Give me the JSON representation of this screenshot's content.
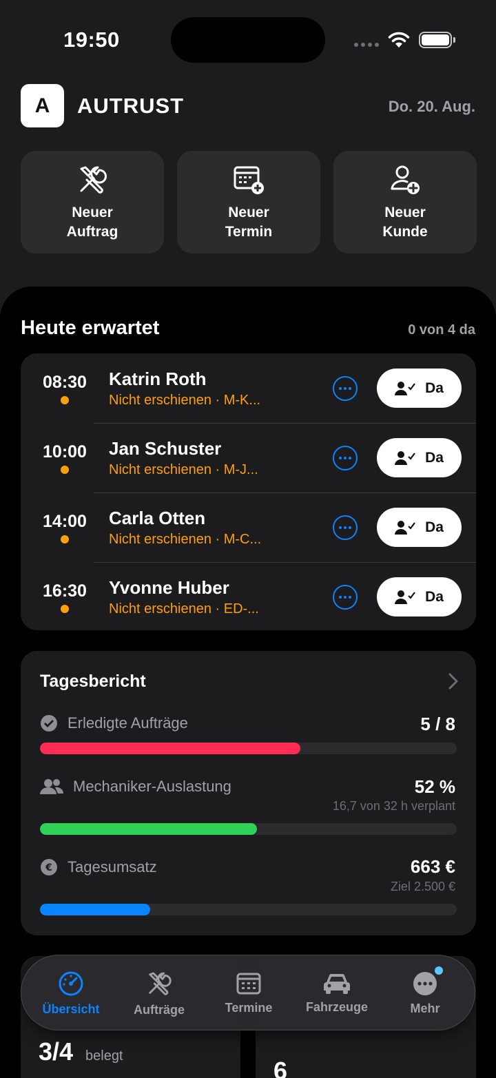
{
  "status": {
    "time": "19:50"
  },
  "header": {
    "logo_letter": "A",
    "brand": "AUTRUST",
    "date": "Do. 20. Aug."
  },
  "quick_actions": [
    {
      "label": "Neuer\nAuftrag",
      "icon": "tools-icon"
    },
    {
      "label": "Neuer\nTermin",
      "icon": "calendar-plus-icon"
    },
    {
      "label": "Neuer\nKunde",
      "icon": "person-plus-icon"
    }
  ],
  "today": {
    "title": "Heute erwartet",
    "count": "0 von 4 da",
    "appointments": [
      {
        "time": "08:30",
        "name": "Katrin Roth",
        "sub": "Nicht erschienen · M-K...",
        "button": "Da"
      },
      {
        "time": "10:00",
        "name": "Jan Schuster",
        "sub": "Nicht erschienen · M-J...",
        "button": "Da"
      },
      {
        "time": "14:00",
        "name": "Carla Otten",
        "sub": "Nicht erschienen · M-C...",
        "button": "Da"
      },
      {
        "time": "16:30",
        "name": "Yvonne Huber",
        "sub": "Nicht erschienen · ED-...",
        "button": "Da"
      }
    ]
  },
  "report": {
    "title": "Tagesbericht",
    "metrics": [
      {
        "label": "Erledigte Aufträge",
        "value": "5 / 8",
        "sub": "",
        "progress": 0.625,
        "color": "#ff2d55",
        "icon": "checkmark-circle-icon"
      },
      {
        "label": "Mechaniker-Auslastung",
        "value": "52 %",
        "sub": "16,7 von 32 h verplant",
        "progress": 0.52,
        "color": "#30d158",
        "icon": "people-icon"
      },
      {
        "label": "Tagesumsatz",
        "value": "663 €",
        "sub": "Ziel 2.500 €",
        "progress": 0.265,
        "color": "#0a84ff",
        "icon": "euro-circle-icon"
      }
    ]
  },
  "peek": {
    "occupancy": "3/4",
    "occupancy_label": "belegt",
    "second_value": "6"
  },
  "tabs": [
    {
      "label": "Übersicht",
      "icon": "gauge-icon",
      "active": true
    },
    {
      "label": "Aufträge",
      "icon": "tools-icon",
      "active": false
    },
    {
      "label": "Termine",
      "icon": "calendar-icon",
      "active": false
    },
    {
      "label": "Fahrzeuge",
      "icon": "car-icon",
      "active": false
    },
    {
      "label": "Mehr",
      "icon": "ellipsis-circle-icon",
      "active": false
    }
  ],
  "colors": {
    "accent": "#0a84ff",
    "warning": "#ff9f0a",
    "background": "#1c1c1e"
  }
}
